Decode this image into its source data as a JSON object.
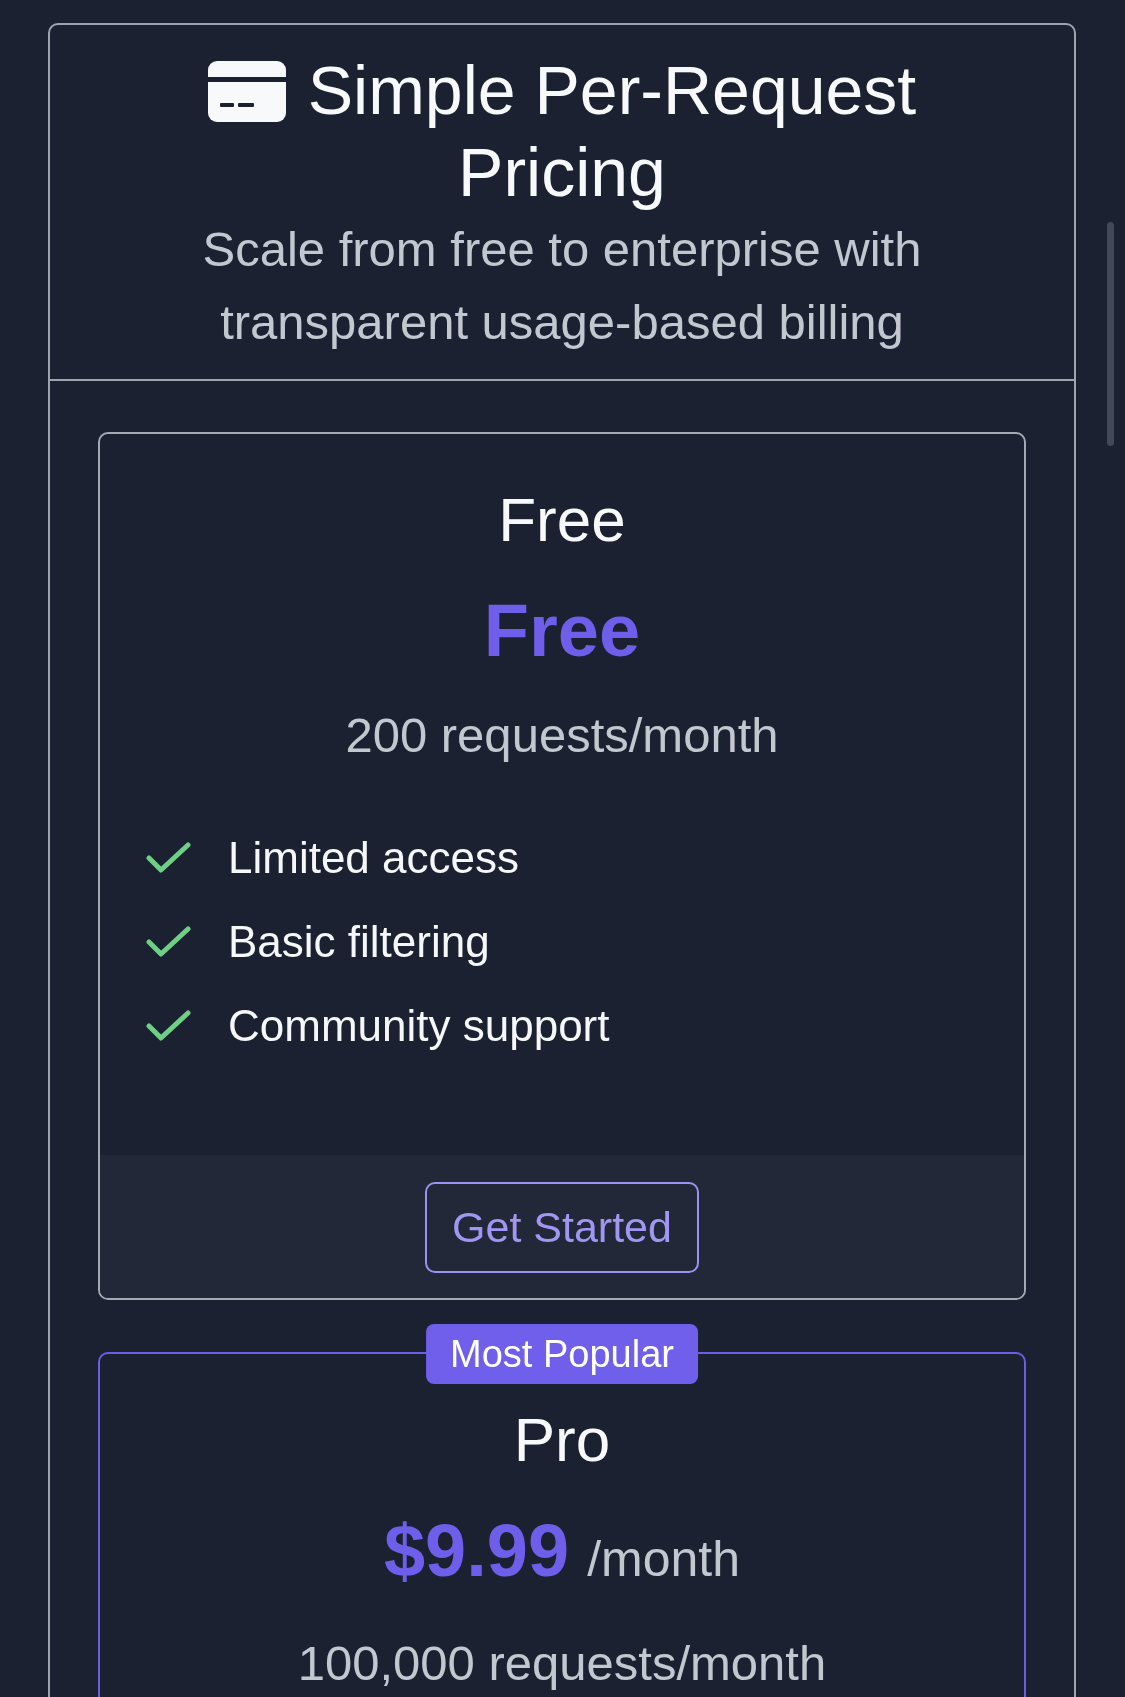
{
  "header": {
    "title": "Simple Per-Request Pricing",
    "subtitle": "Scale from free to enterprise with transparent usage-based billing"
  },
  "plans": [
    {
      "name": "Free",
      "featured": false,
      "price": "Free",
      "quota": "200 requests/month",
      "features": [
        "Limited access",
        "Basic filtering",
        "Community support"
      ],
      "button": "Get Started"
    },
    {
      "name": "Pro",
      "featured": true,
      "badge": "Most Popular",
      "price": "$9.99",
      "period": "/month",
      "quota": "100,000 requests/month"
    }
  ]
}
